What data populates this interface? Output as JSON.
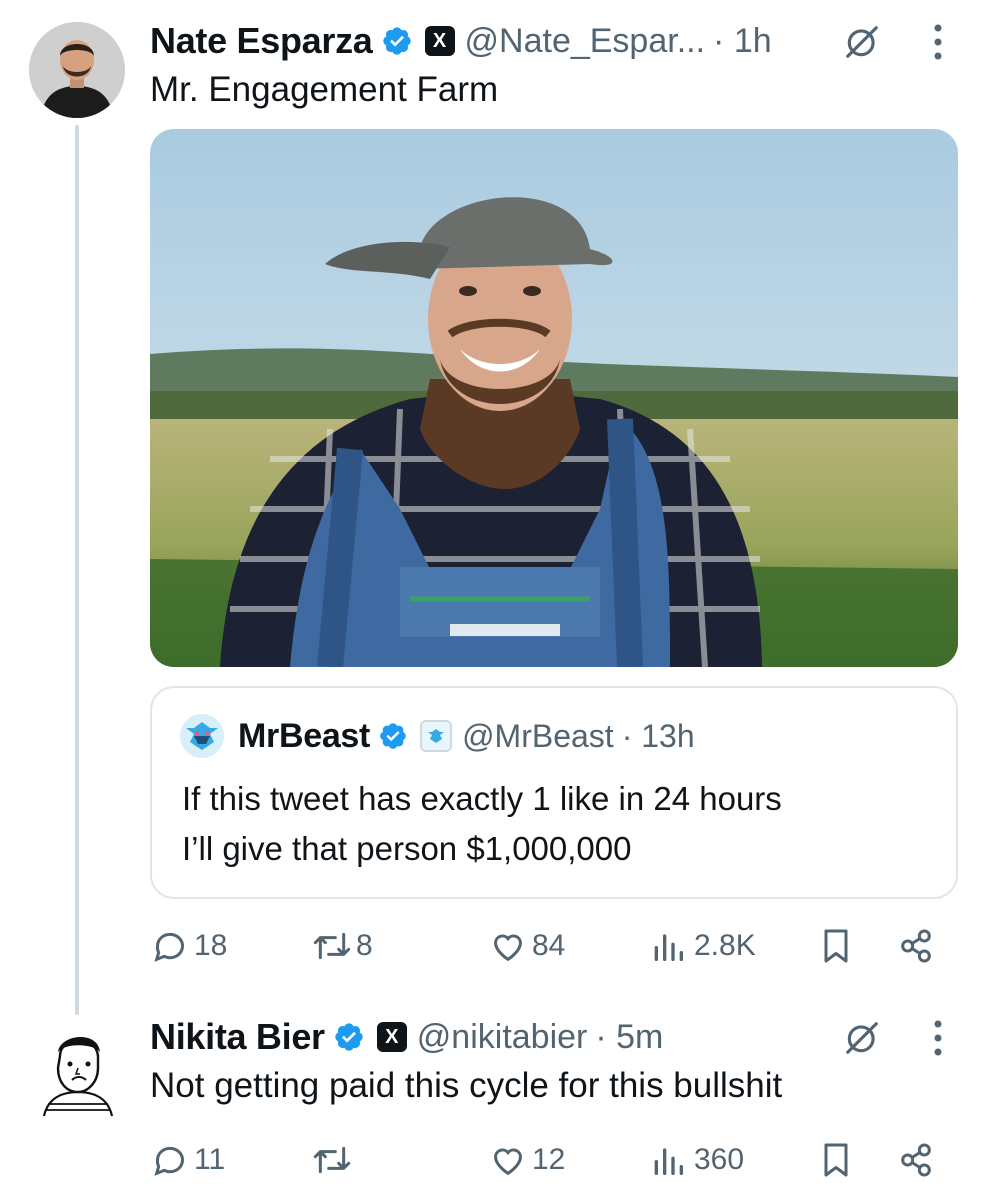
{
  "tweet1": {
    "author_name": "Nate Esparza",
    "platform_badge": "X",
    "handle": "@Nate_Espar...",
    "time": "· 1h",
    "text": "Mr. Engagement Farm",
    "media_icon": "photo",
    "quote": {
      "author_name": "MrBeast",
      "handle": "@MrBeast",
      "time": "· 13h",
      "text_line1": "If this tweet has exactly 1 like in 24 hours",
      "text_line2": "I’ll give that person $1,000,000"
    },
    "stats": {
      "replies": "18",
      "reposts": "8",
      "likes": "84",
      "views": "2.8K"
    }
  },
  "tweet2": {
    "author_name": "Nikita Bier",
    "platform_badge": "X",
    "handle": "@nikitabier",
    "time": "· 5m",
    "text": "Not getting paid this cycle for this bullshit",
    "stats": {
      "replies": "11",
      "reposts": "",
      "likes": "12",
      "views": "360"
    }
  },
  "icons": {
    "verified": "verified-badge-icon",
    "grok": "grok-icon",
    "more": "more-dots-icon",
    "reply": "reply-icon",
    "repost": "repost-icon",
    "like": "like-icon",
    "views": "views-icon",
    "bookmark": "bookmark-icon",
    "share": "share-icon"
  },
  "colors": {
    "accent": "#1d9bf0",
    "text": "#0f1419",
    "muted": "#536471",
    "line": "#cfd9de"
  }
}
